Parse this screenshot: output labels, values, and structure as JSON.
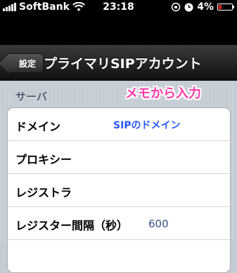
{
  "status_bar": {
    "carrier": "SoftBank",
    "time": "23:18",
    "battery_percent": "4%",
    "battery_level": 0.04
  },
  "nav_bar": {
    "back_label": "設定",
    "title": "プライマリSIPアカウント"
  },
  "section": {
    "header": "サーバ"
  },
  "annotations": {
    "memo": "メモから入力",
    "sip_domain": "SIPのドメイン"
  },
  "rows": [
    {
      "label": "ドメイン",
      "value": ""
    },
    {
      "label": "プロキシー",
      "value": ""
    },
    {
      "label": "レジストラ",
      "value": ""
    },
    {
      "label": "レジスター間隔（秒）",
      "value": "600"
    },
    {
      "label": "",
      "value": ""
    }
  ],
  "colors": {
    "annotation_memo": "#ff3aa8",
    "annotation_sip": "#2a58ff",
    "value_text": "#385487",
    "battery_low": "#e02020"
  }
}
